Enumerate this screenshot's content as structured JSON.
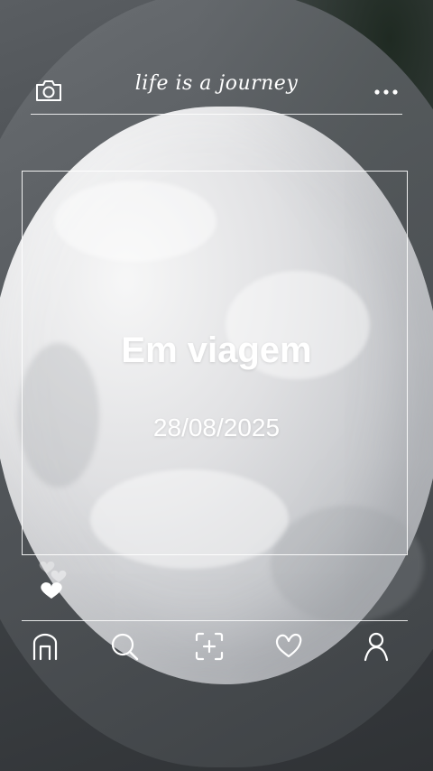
{
  "header": {
    "title": "life is a journey",
    "camera_icon": "camera-icon",
    "more_icon": "more-horizontal-icon"
  },
  "card": {
    "title": "Em viagem",
    "date": "28/08/2025"
  },
  "hearts_icon": "hearts-icon",
  "nav": {
    "items": [
      {
        "icon": "home-icon"
      },
      {
        "icon": "search-icon"
      },
      {
        "icon": "add-photo-icon"
      },
      {
        "icon": "heart-icon"
      },
      {
        "icon": "profile-icon"
      }
    ]
  },
  "colors": {
    "foreground": "#ffffff",
    "background_dark": "#3a3d40",
    "frosting": "#eeeff1"
  }
}
